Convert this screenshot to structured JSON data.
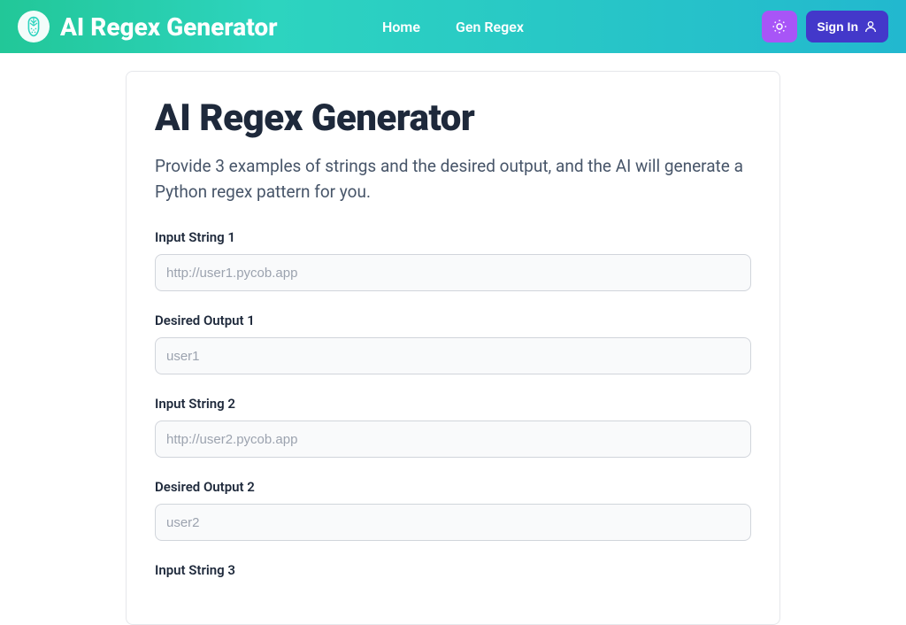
{
  "navbar": {
    "brand": "AI Regex Generator",
    "links": {
      "home": "Home",
      "gen_regex": "Gen Regex"
    },
    "signin": "Sign In"
  },
  "main": {
    "title": "AI Regex Generator",
    "subtitle": "Provide 3 examples of strings and the desired output, and the AI will generate a Python regex pattern for you.",
    "fields": [
      {
        "label": "Input String 1",
        "placeholder": "http://user1.pycob.app",
        "value": ""
      },
      {
        "label": "Desired Output 1",
        "placeholder": "user1",
        "value": ""
      },
      {
        "label": "Input String 2",
        "placeholder": "http://user2.pycob.app",
        "value": ""
      },
      {
        "label": "Desired Output 2",
        "placeholder": "user2",
        "value": ""
      },
      {
        "label": "Input String 3",
        "placeholder": "",
        "value": ""
      }
    ]
  }
}
